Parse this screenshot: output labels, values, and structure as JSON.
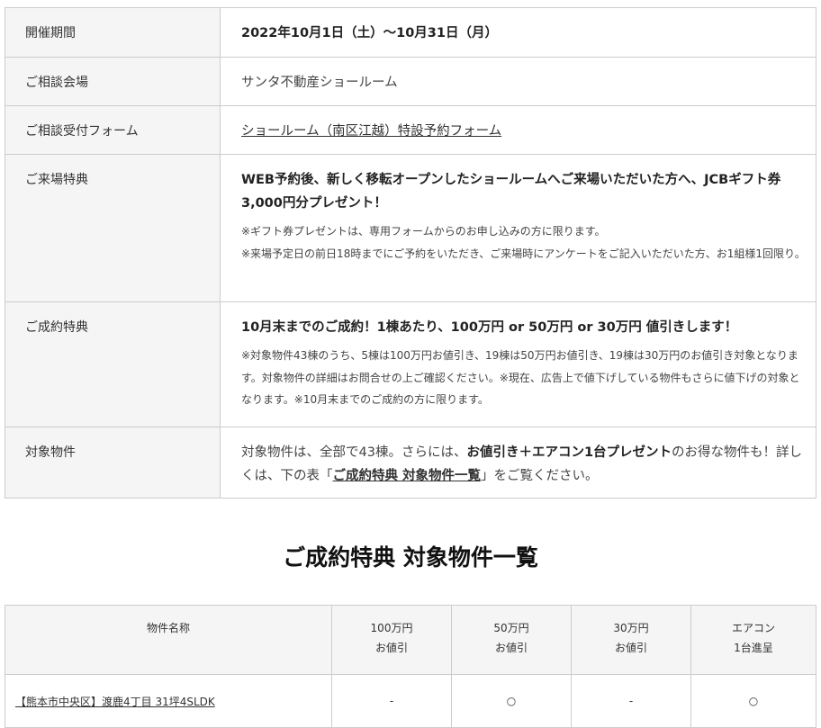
{
  "info": {
    "period_label": "開催期間",
    "period_value": "2022年10月1日（土）～10月31日（月）",
    "venue_label": "ご相談会場",
    "venue_value": "サンタ不動産ショールーム",
    "form_label": "ご相談受付フォーム",
    "form_link": "ショールーム（南区江越）特設予約フォーム",
    "visit_label": "ご来場特典",
    "visit_main": "WEB予約後、新しく移転オープンしたショールームへご来場いただいた方へ、JCBギフト券3,000円分プレゼント！",
    "visit_note1": "※ギフト券プレゼントは、専用フォームからのお申し込みの方に限ります。",
    "visit_note2": "※来場予定日の前日18時までにご予約をいただき、ご来場時にアンケートをご記入いただいた方、お1組様1回限り。",
    "contract_label": "ご成約特典",
    "contract_main": "10月末までのご成約！1棟あたり、100万円 or 50万円 or 30万円 値引きします！",
    "contract_note": "※対象物件43棟のうち、5棟は100万円お値引き、19棟は50万円お値引き、19棟は30万円のお値引き対象となります。対象物件の詳細はお問合せの上ご確認ください。※現在、広告上で値下げしている物件もさらに値下げの対象となります。※10月末までのご成約の方に限ります。",
    "target_label": "対象物件",
    "target_text1": "対象物件は、全部で43棟。さらには、",
    "target_strong": "お値引き＋エアコン1台プレゼント",
    "target_text2": "のお得な物件も！詳しくは、下の表「",
    "target_link": "ご成約特典 対象物件一覧",
    "target_text3": "」をご覧ください。"
  },
  "section_title": "ご成約特典 対象物件一覧",
  "list": {
    "headers": {
      "name": "物件名称",
      "c100_line1": "100万円",
      "c100_line2": "お値引",
      "c50_line1": "50万円",
      "c50_line2": "お値引",
      "c30_line1": "30万円",
      "c30_line2": "お値引",
      "ac_line1": "エアコン",
      "ac_line2": "1台進呈"
    },
    "rows": [
      {
        "name": "【熊本市中央区】渡鹿4丁目 31坪4SLDK",
        "c100": "-",
        "c50": "○",
        "c30": "-",
        "ac": "○"
      }
    ]
  }
}
